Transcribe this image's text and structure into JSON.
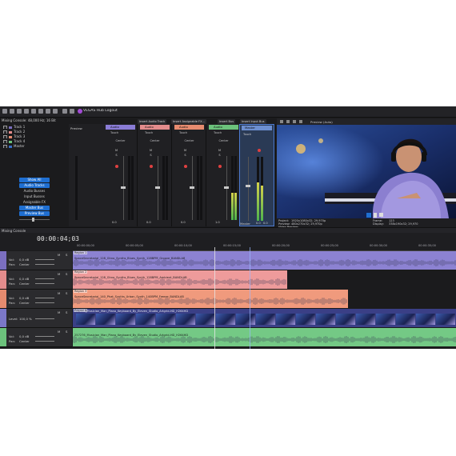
{
  "app": {
    "title": "VEGAS Hub Logout"
  },
  "colors": {
    "accent": "#1f6fd1",
    "track1": "#7b6fc0",
    "track2": "#e38c8c",
    "track3": "#e68b6f",
    "track4": "#8a8aa0",
    "track5": "#6cc27c"
  },
  "mixing_console": {
    "header": "Mixing Console: 48,000 Hz; 16 Bit",
    "tracks": [
      {
        "label": "Track 1",
        "color": "#7b6fc0"
      },
      {
        "label": "Track 2",
        "color": "#e38c8c"
      },
      {
        "label": "Track 3",
        "color": "#e68b6f"
      },
      {
        "label": "Track 4",
        "color": "#6cc27c"
      },
      {
        "label": "Master",
        "color": "#3a6fc8"
      }
    ],
    "buttons": {
      "show_all": "Show All",
      "audio_tracks": "Audio Tracks",
      "audio_busses": "Audio Busses",
      "input_busses": "Input Busses",
      "assignable_fx": "Assignable FX",
      "master_bus": "Master Bus",
      "preview_bus": "Preview Bus"
    },
    "insert_tabs": [
      "Insert Audio Track",
      "Insert Assignable FX...",
      "Insert Bus",
      "Insert Input Bus"
    ],
    "strips": [
      {
        "name": "Audio",
        "color": "#8a7cd6",
        "touch": "Touch",
        "pan": "Center",
        "level": "0.0"
      },
      {
        "name": "Audio",
        "color": "#e38c8c",
        "touch": "Touch",
        "pan": "Center",
        "level": "0.0"
      },
      {
        "name": "Audio",
        "color": "#e68b6f",
        "touch": "Touch",
        "pan": "Center",
        "level": "0.0"
      },
      {
        "name": "Audio",
        "color": "#6cc27c",
        "touch": "Touch",
        "pan": "Center",
        "level": "1.0"
      },
      {
        "name": "Audio",
        "color": "#8a8aa0",
        "touch": "Touch",
        "pan": "Center",
        "level": "0.0"
      }
    ],
    "preview_label": "Preview",
    "master": {
      "name": "Master",
      "touch": "Touch",
      "levels": [
        "0.0",
        "0.0"
      ],
      "label": "Master"
    },
    "bottom_label": "Mixing Console"
  },
  "video_preview": {
    "mode": "Preview (Auto)",
    "tab": "Video Preview",
    "project_label": "Project:",
    "project": "1920x1080x32; 29,970p",
    "preview_label": "Preview:",
    "preview": "480x270x32; 29,970p",
    "display_label": "Display:",
    "display": "338x190x32; 29,970",
    "frame_label": "Frame:",
    "frame": "123"
  },
  "timeline": {
    "timecode": "00:00:04;03",
    "ruler": [
      "00:00:00;00",
      "00:00:05;00",
      "00:00:10;00",
      "00:00:15;00",
      "00:00:20;00",
      "00:00:25;00",
      "00:00:30;00",
      "00:00:35;00"
    ],
    "tracks": [
      {
        "vol_label": "Vol:",
        "vol": "0,0 dB",
        "pan_label": "Pan:",
        "pan": "Center",
        "clip_label": "Region 1",
        "clip_name": "SpaceSecretarial_128_Ghno_Synths_Blues_Synth_128BPM_Groove_BANDLAB"
      },
      {
        "vol_label": "Vol:",
        "vol": "0,0 dB",
        "pan_label": "Pan:",
        "pan": "Center",
        "clip_label": "Region 2",
        "clip_name": "SpaceSecretarial_128_Ghno_Synths_Blues_Synth_128BPM_Ambient_BANDLAB"
      },
      {
        "vol_label": "Vol:",
        "vol": "0,0 dB",
        "pan_label": "Pan:",
        "pan": "Center",
        "clip_label": "Region 3",
        "clip_name": "SpaceSecretarial_140_Phat_Synths_Urban_Synth_140BPM_Freeze_BANDLAB"
      },
      {
        "level_label": "Level:",
        "level": "100,0 %",
        "clip_label": "Region 4",
        "clip_name": "257276_Musician_Man_Piano_Keyboard_By_Eleven_Studio_Artgrid-HD_H264HD"
      },
      {
        "vol_label": "Vol:",
        "vol": "0,0 dB",
        "pan_label": "Pan:",
        "pan": "Center",
        "clip_label": "",
        "clip_name": "257276_Musician_Man_Piano_Keyboard_By_Eleven_Studio_Artgrid-HD_H264HD"
      }
    ]
  }
}
